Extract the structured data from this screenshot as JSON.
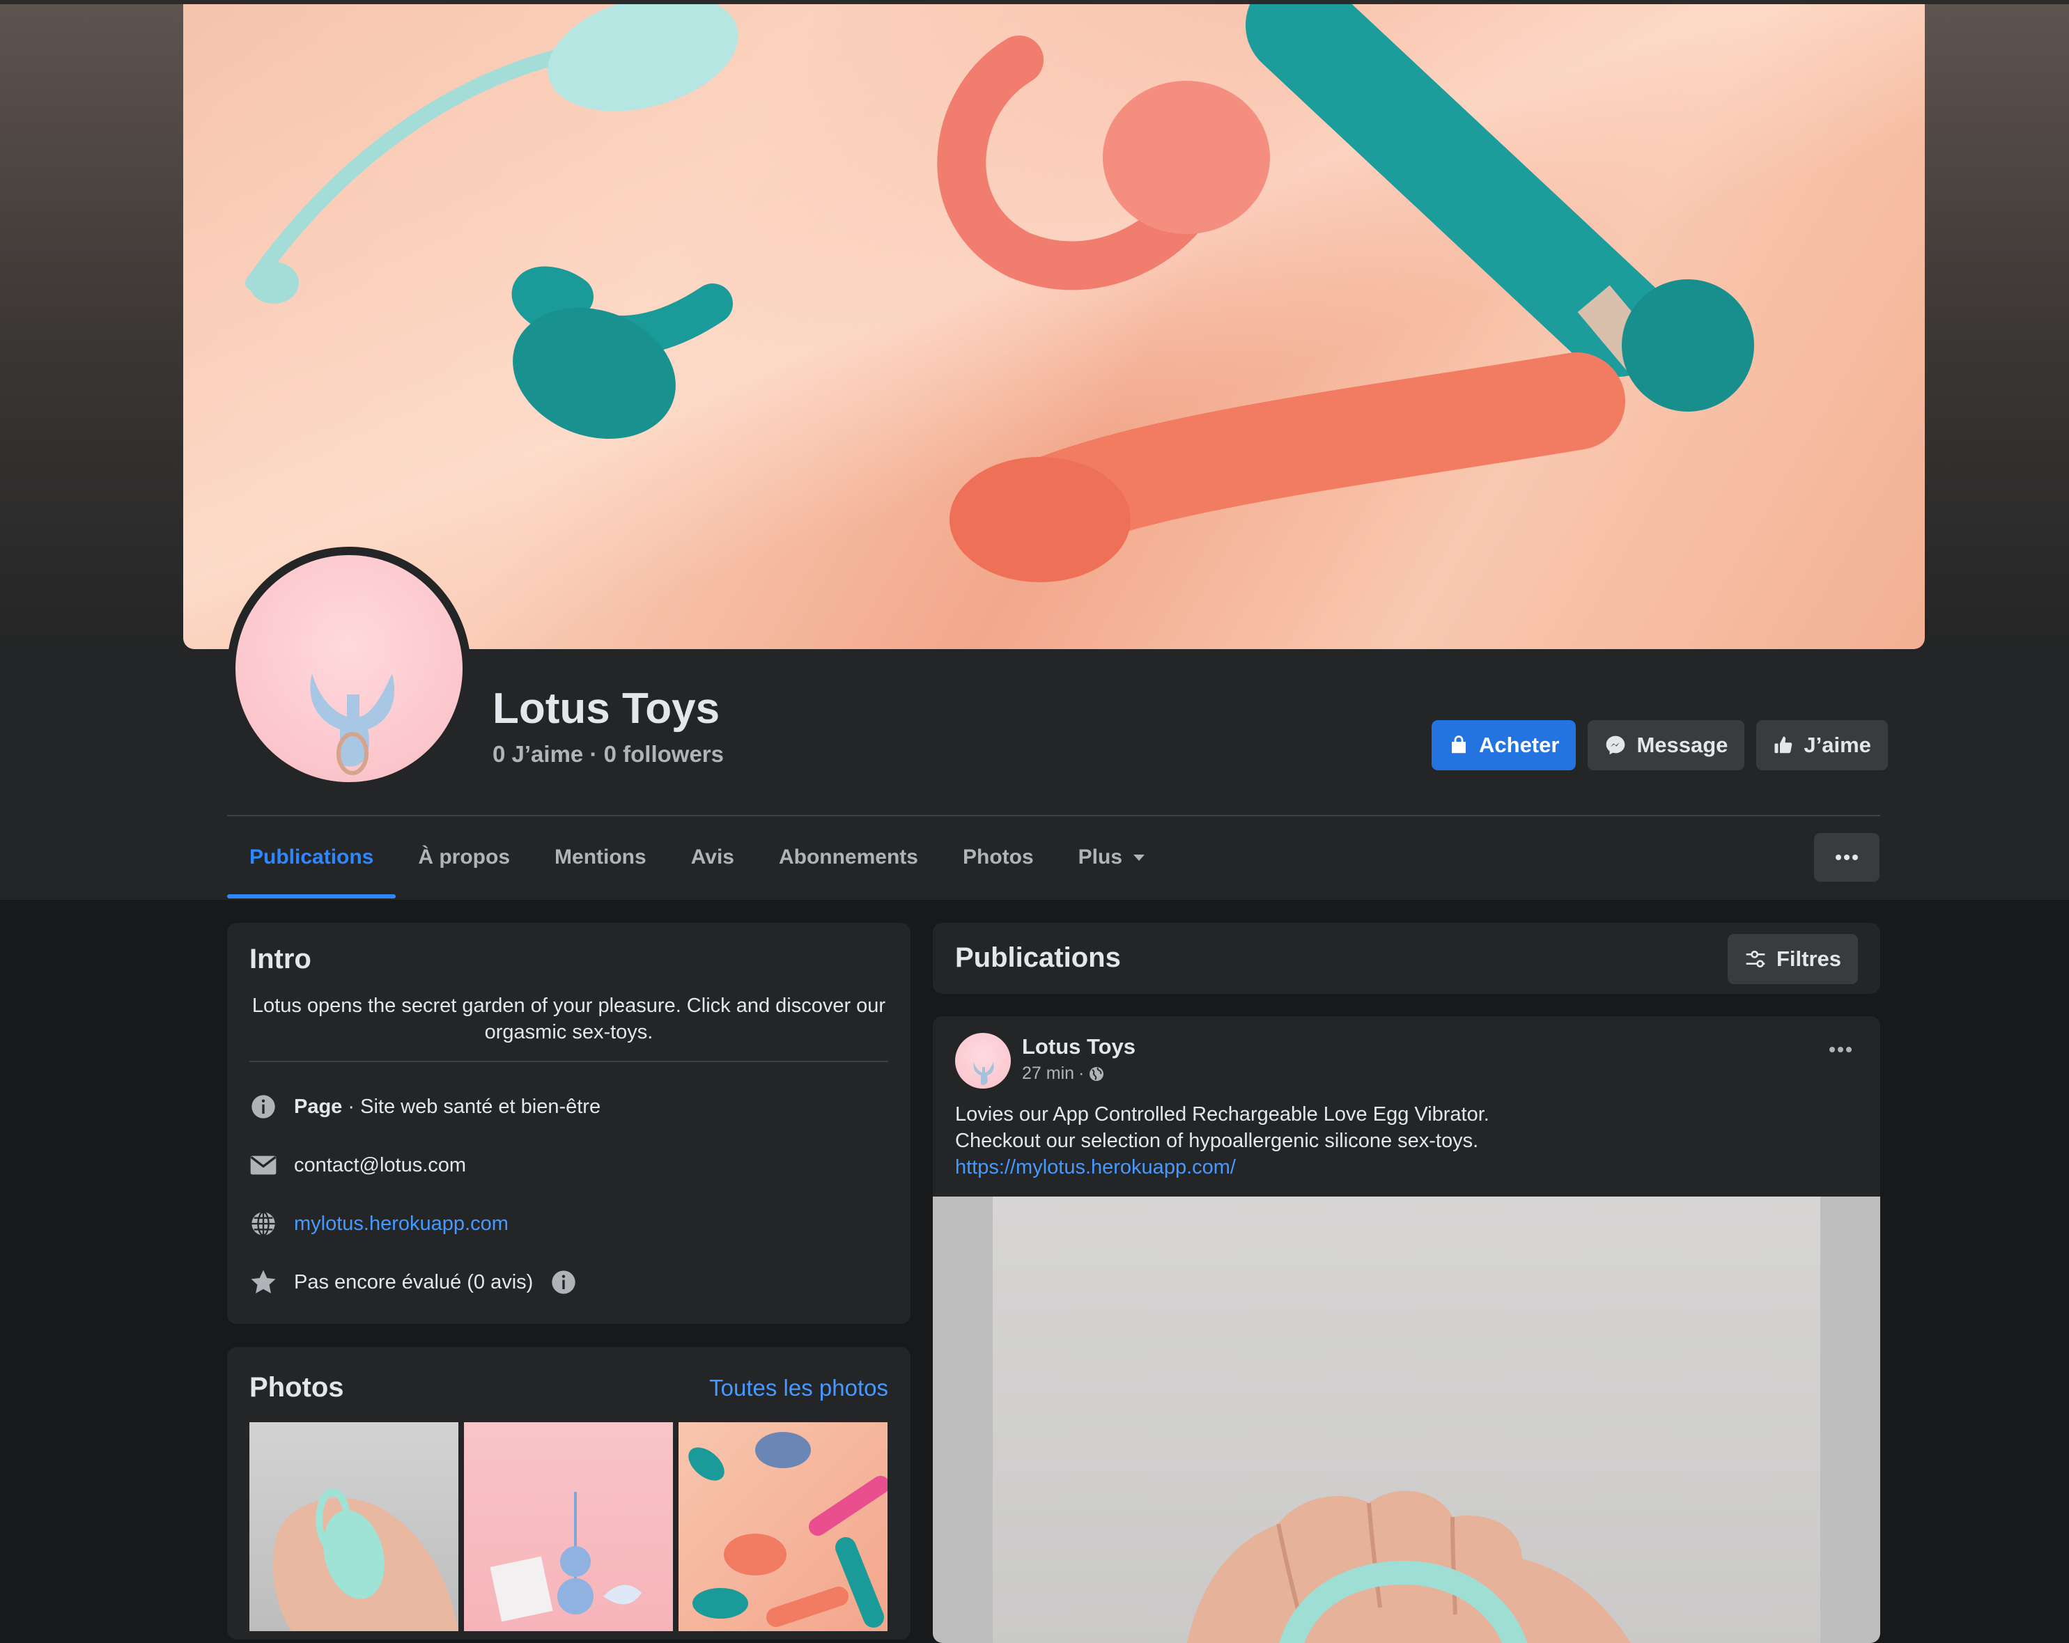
{
  "page": {
    "name": "Lotus Toys",
    "likes": "0 J’aime",
    "separator": "·",
    "followers": "0 followers"
  },
  "actions": {
    "buy_label": "Acheter",
    "message_label": "Message",
    "like_label": "J’aime"
  },
  "tabs": [
    {
      "label": "Publications",
      "active": true
    },
    {
      "label": "À propos"
    },
    {
      "label": "Mentions"
    },
    {
      "label": "Avis"
    },
    {
      "label": "Abonnements"
    },
    {
      "label": "Photos"
    },
    {
      "label": "Plus"
    }
  ],
  "intro": {
    "title": "Intro",
    "description": "Lotus opens the secret garden of your pleasure. Click and discover our orgasmic sex-toys.",
    "category_label": "Page",
    "category_value": " · Site web santé et bien-être",
    "email": "contact@lotus.com",
    "website": "mylotus.herokuapp.com",
    "rating": "Pas encore évalué (0 avis)"
  },
  "photos": {
    "title": "Photos",
    "see_all": "Toutes les photos"
  },
  "publications": {
    "title": "Publications",
    "filter_label": "Filtres"
  },
  "post": {
    "author": "Lotus Toys",
    "time": "27 min",
    "meta_separator": "·",
    "audience_icon": "globe-icon",
    "line1": "Lovies our App Controlled Rechargeable Love Egg Vibrator.",
    "line2": "Checkout our selection of hypoallergenic silicone sex-toys.",
    "link": "https://mylotus.herokuapp.com/"
  },
  "colors": {
    "accent": "#2374e1",
    "link": "#4599ff",
    "card": "#242526",
    "background": "#18191a"
  }
}
